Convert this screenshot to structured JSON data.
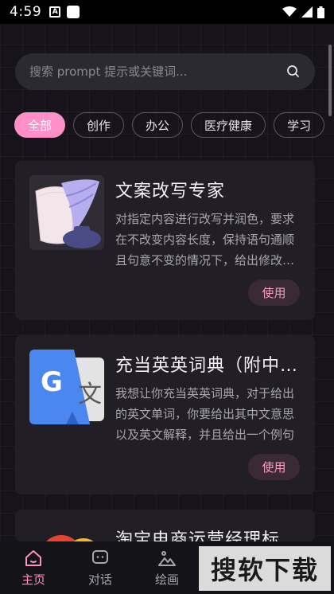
{
  "status_bar": {
    "time": "4:59",
    "a_badge": "A"
  },
  "search": {
    "placeholder": "搜索 prompt 提示或关键词..."
  },
  "categories": [
    "全部",
    "创作",
    "办公",
    "医疗健康",
    "学习"
  ],
  "active_category": "全部",
  "cards": [
    {
      "title": "文案改写专家",
      "description": "对指定内容进行改写并润色，要求在不改变内容长度，保持语句通顺且句意不变的情况下，给出修改后的文案",
      "button": "使用",
      "icon": "quill-ink-icon"
    },
    {
      "title": "充当英英词典（附中文解释）",
      "description": "我想让你充当英英词典，对于给出的英文单词，你要给出其中文意思以及英文解释，并且给出一个例句",
      "button": "使用",
      "icon": "google-translate-icon"
    },
    {
      "title": "淘宝电商运营经理标题优化",
      "icon": "taobao-icon"
    }
  ],
  "bottom_nav": [
    {
      "label": "主页",
      "icon": "home-icon"
    },
    {
      "label": "对话",
      "icon": "chat-icon"
    },
    {
      "label": "绘画",
      "icon": "mountain-icon"
    }
  ],
  "watermark": "搜软下载",
  "colors": {
    "accent": "#ff8fc8",
    "background": "#16141a",
    "card": "#211f25"
  }
}
